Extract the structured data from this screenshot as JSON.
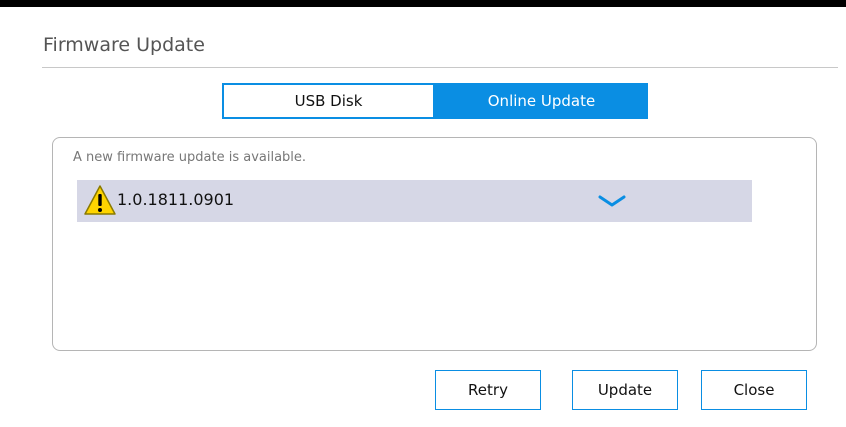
{
  "dialog": {
    "title": "Firmware Update"
  },
  "tabs": [
    {
      "label": "USB Disk",
      "selected": false
    },
    {
      "label": "Online Update",
      "selected": true
    }
  ],
  "panel": {
    "message": "A new firmware update is available.",
    "version_item": {
      "icon": "warning-icon",
      "version": "1.0.1811.0901",
      "expand_icon": "chevron-down-icon"
    }
  },
  "buttons": {
    "retry": "Retry",
    "update": "Update",
    "close": "Close"
  },
  "colors": {
    "accent": "#0a8ee3",
    "row_background": "#d6d7e6",
    "warning_yellow": "#ffd400"
  }
}
